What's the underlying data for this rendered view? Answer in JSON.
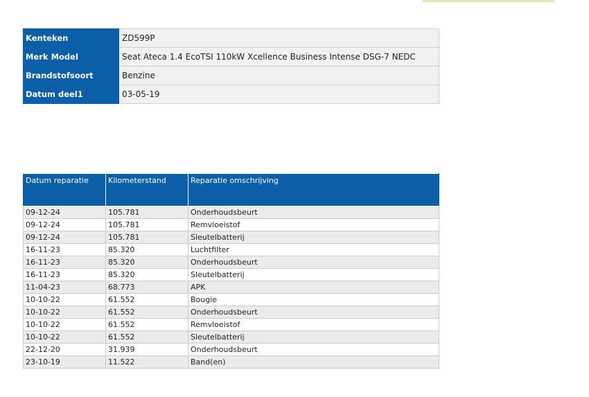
{
  "vehicle": {
    "rows": [
      {
        "label": "Kenteken",
        "value": "ZD599P"
      },
      {
        "label": "Merk Model",
        "value": "Seat Ateca 1.4 EcoTSI 110kW Xcellence Business Intense DSG-7 NEDC"
      },
      {
        "label": "Brandstofsoort",
        "value": "Benzine"
      },
      {
        "label": "Datum deel1",
        "value": "03-05-19"
      }
    ]
  },
  "repairs": {
    "headers": [
      "Datum reparatie",
      "Kilometerstand",
      "Reparatie omschrijving"
    ],
    "rows": [
      {
        "date": "09-12-24",
        "km": "105.781",
        "description": "Onderhoudsbeurt"
      },
      {
        "date": "09-12-24",
        "km": "105.781",
        "description": "Remvloeistof"
      },
      {
        "date": "09-12-24",
        "km": "105.781",
        "description": "Sleutelbatterij"
      },
      {
        "date": "16-11-23",
        "km": "85.320",
        "description": "Luchtfilter"
      },
      {
        "date": "16-11-23",
        "km": "85.320",
        "description": "Onderhoudsbeurt"
      },
      {
        "date": "16-11-23",
        "km": "85.320",
        "description": "Sleutelbatterij"
      },
      {
        "date": "11-04-23",
        "km": "68.773",
        "description": "APK"
      },
      {
        "date": "10-10-22",
        "km": "61.552",
        "description": "Bougie"
      },
      {
        "date": "10-10-22",
        "km": "61.552",
        "description": "Onderhoudsbeurt"
      },
      {
        "date": "10-10-22",
        "km": "61.552",
        "description": "Remvloeistof"
      },
      {
        "date": "10-10-22",
        "km": "61.552",
        "description": "Sleutelbatterij"
      },
      {
        "date": "22-12-20",
        "km": "31.939",
        "description": "Onderhoudsbeurt"
      },
      {
        "date": "23-10-19",
        "km": "11.522",
        "description": "Band(en)"
      }
    ]
  },
  "colors": {
    "header_blue": "#0a5fa8",
    "row_shade": "#ebebeb",
    "accent": "#dfe9b8"
  }
}
